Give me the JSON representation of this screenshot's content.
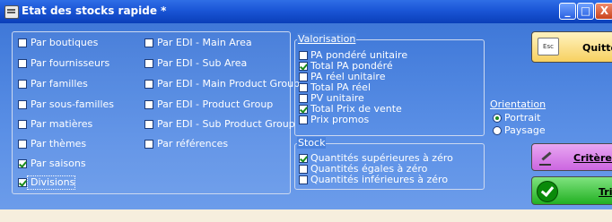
{
  "window": {
    "title": "Etat des stocks rapide *",
    "minimize": "_",
    "maximize": "□",
    "close": "X"
  },
  "grouping": {
    "left_column": [
      {
        "label": "Par boutiques",
        "checked": false
      },
      {
        "label": "Par fournisseurs",
        "checked": false
      },
      {
        "label": "Par familles",
        "checked": false
      },
      {
        "label": "Par sous-familles",
        "checked": false
      },
      {
        "label": "Par matières",
        "checked": false
      },
      {
        "label": "Par thèmes",
        "checked": false
      },
      {
        "label": "Par saisons",
        "checked": true
      },
      {
        "label": "Divisions",
        "checked": true
      }
    ],
    "right_column": [
      {
        "label": "Par EDI - Main Area",
        "checked": false
      },
      {
        "label": "Par EDI - Sub Area",
        "checked": false
      },
      {
        "label": "Par EDI - Main Product Group",
        "checked": false
      },
      {
        "label": "Par EDI - Product Group",
        "checked": false
      },
      {
        "label": "Par EDI - Sub Product Group",
        "checked": false
      },
      {
        "label": "Par références",
        "checked": false
      }
    ]
  },
  "valorisation": {
    "title": "Valorisation",
    "items": [
      {
        "label": "PA pondéré unitaire",
        "checked": false
      },
      {
        "label": "Total PA pondéré",
        "checked": true
      },
      {
        "label": "PA réel unitaire",
        "checked": false
      },
      {
        "label": "Total PA réel",
        "checked": false
      },
      {
        "label": "PV unitaire",
        "checked": false
      },
      {
        "label": "Total Prix de vente",
        "checked": true
      },
      {
        "label": "Prix promos",
        "checked": false
      }
    ]
  },
  "stock": {
    "title": "Stock",
    "items": [
      {
        "label": "Quantités supérieures à zéro",
        "checked": true
      },
      {
        "label": "Quantités égales à zéro",
        "checked": false
      },
      {
        "label": "Quantités inférieures à zéro",
        "checked": false
      }
    ]
  },
  "orientation": {
    "title": "Orientation",
    "options": [
      {
        "label": "Portrait",
        "selected": true
      },
      {
        "label": "Paysage",
        "selected": false
      }
    ]
  },
  "buttons": {
    "quit_label": "Quitter",
    "esc_key": "Esc",
    "criteria_label": "Critères",
    "sort_label": "Tri"
  }
}
